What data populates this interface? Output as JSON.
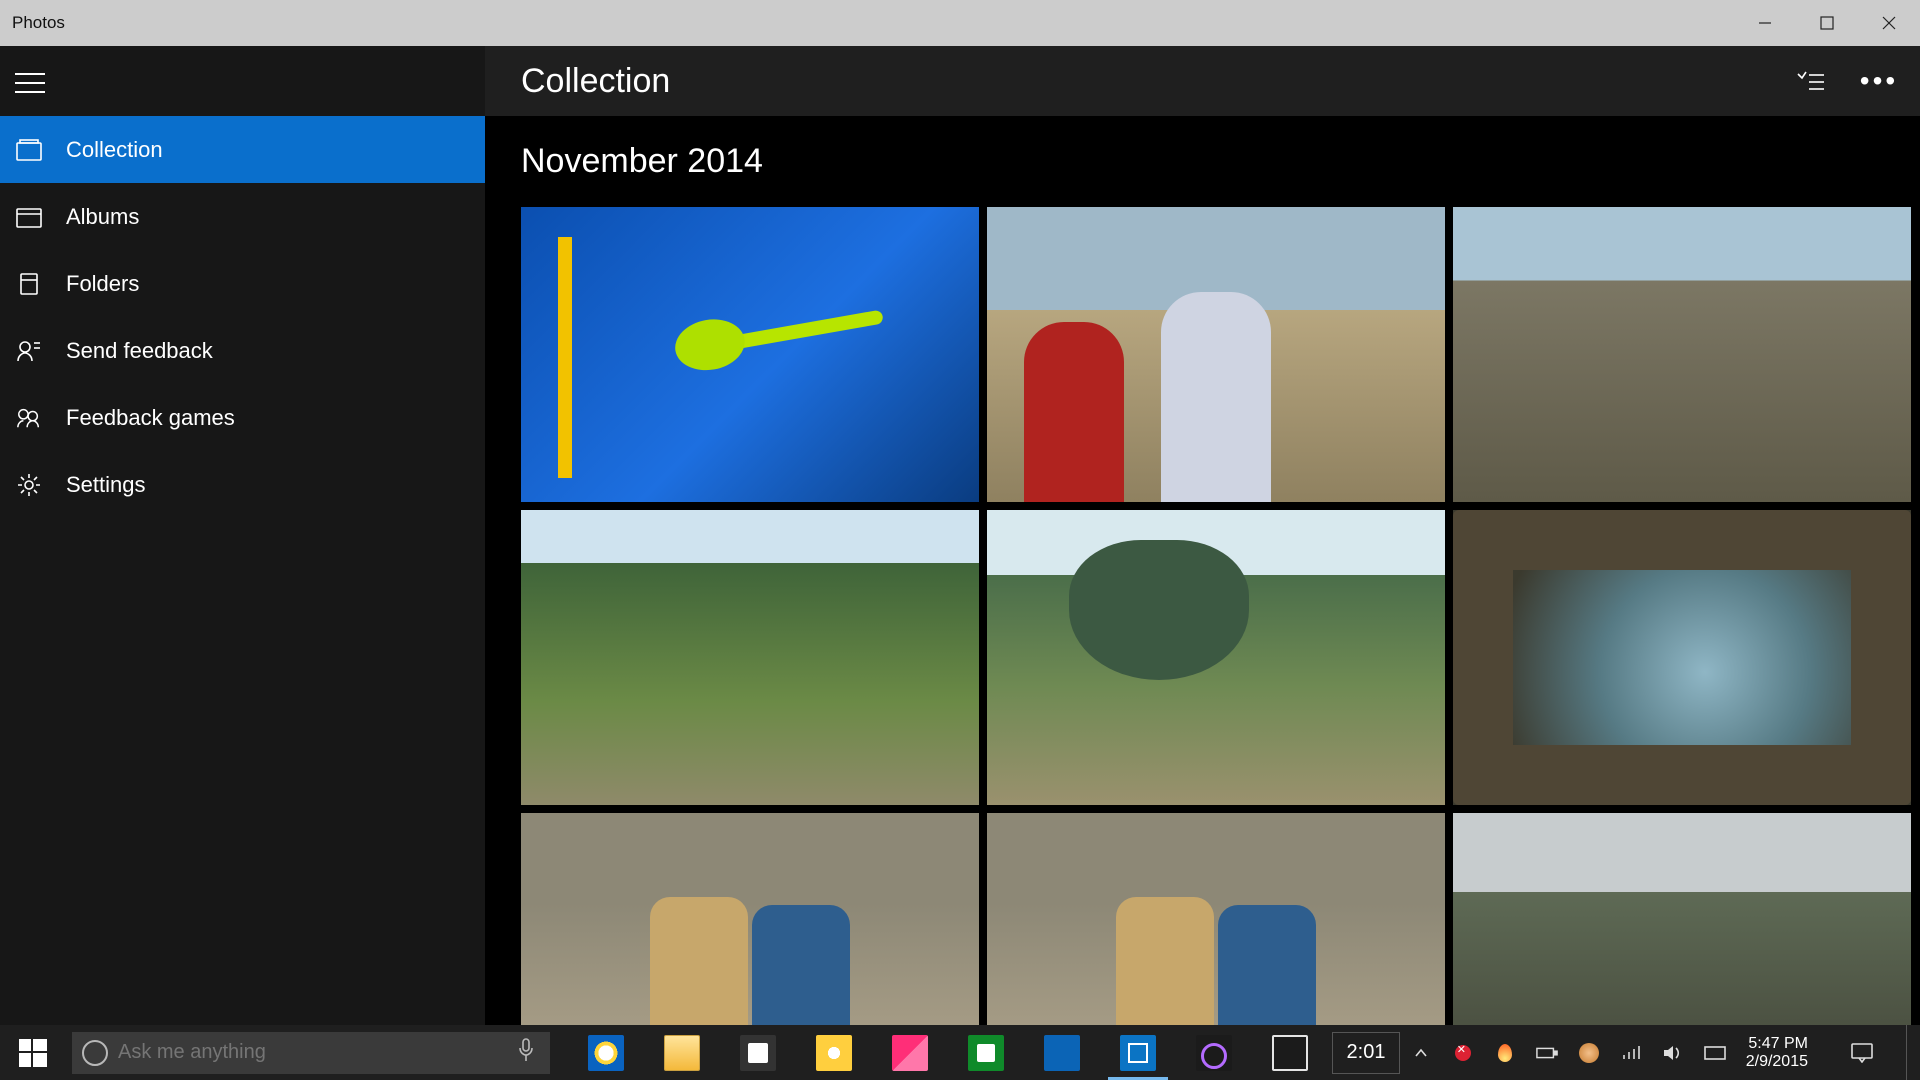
{
  "window": {
    "title": "Photos"
  },
  "sidebar": {
    "items": [
      {
        "key": "collection",
        "label": "Collection",
        "active": true
      },
      {
        "key": "albums",
        "label": "Albums"
      },
      {
        "key": "folders",
        "label": "Folders"
      },
      {
        "key": "feedback",
        "label": "Send feedback"
      },
      {
        "key": "fbgames",
        "label": "Feedback games"
      },
      {
        "key": "settings",
        "label": "Settings"
      }
    ]
  },
  "main": {
    "header_title": "Collection",
    "date_heading": "November 2014",
    "thumb_count": 9
  },
  "taskbar": {
    "search_placeholder": "Ask me anything",
    "clock_small": "2:01",
    "time": "5:47 PM",
    "date": "2/9/2015"
  }
}
